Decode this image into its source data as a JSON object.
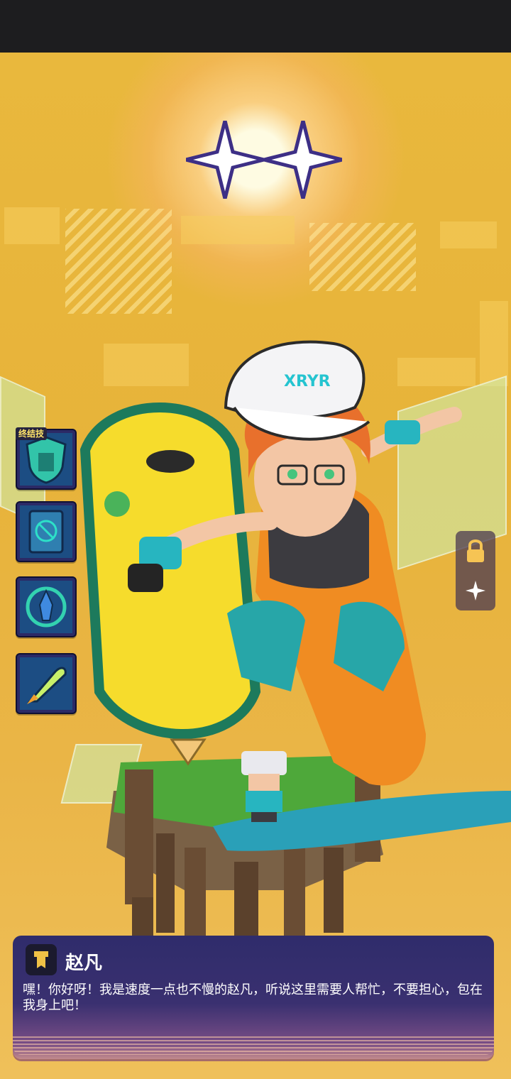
{
  "scene": {
    "star_count": 2,
    "colors": {
      "background": "#e7b437",
      "dialog": "#2f2c6b",
      "accent": "#ffe46a"
    }
  },
  "skills": [
    {
      "icon": "shield-circuit-icon",
      "tag": "终结技"
    },
    {
      "icon": "skull-tablet-icon"
    },
    {
      "icon": "rocket-cycle-icon"
    },
    {
      "icon": "missile-icon"
    }
  ],
  "side_buttons": [
    {
      "icon": "lock-icon"
    },
    {
      "icon": "sparkle-icon"
    }
  ],
  "dialog": {
    "speaker_icon": "faction-emblem-icon",
    "speaker_name": "赵凡",
    "text": "嘿！你好呀！我是速度一点也不慢的赵凡，听说这里需要人帮忙，不要担心，包在我身上吧！"
  }
}
